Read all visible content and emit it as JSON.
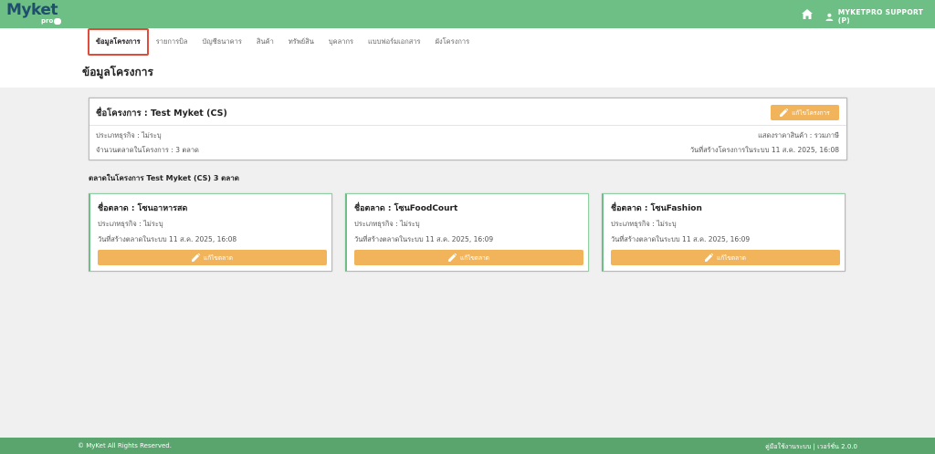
{
  "header": {
    "logo_text": "Myket",
    "logo_sub": "pro",
    "user_name": "MYKETPRO SUPPORT (P)"
  },
  "nav": {
    "tabs": [
      {
        "label": "ข้อมูลโครงการ",
        "active": true
      },
      {
        "label": "รายการบิล"
      },
      {
        "label": "บัญชีธนาคาร"
      },
      {
        "label": "สินค้า"
      },
      {
        "label": "ทรัพย์สิน"
      },
      {
        "label": "บุคลากร"
      },
      {
        "label": "แบบฟอร์มเอกสาร"
      },
      {
        "label": "ผังโครงการ"
      }
    ],
    "page_title": "ข้อมูลโครงการ"
  },
  "project": {
    "title": "ชื่อโครงการ : Test Myket (CS)",
    "edit_label": "แก้ไขโครงการ",
    "business_type": "ประเภทธุรกิจ : ไม่ระบุ",
    "market_count": "จำนวนตลาดในโครงการ : 3 ตลาด",
    "price_display": "แสดงราคาสินค้า : รวมภาษี",
    "created": "วันที่สร้างโครงการในระบบ 11 ส.ค. 2025, 16:08"
  },
  "markets_section_label": "ตลาดในโครงการ Test Myket (CS) 3 ตลาด",
  "markets": [
    {
      "title": "ชื่อตลาด : โซนอาหารสด",
      "business_type": "ประเภทธุรกิจ : ไม่ระบุ",
      "created": "วันที่สร้างตลาดในระบบ 11 ส.ค. 2025, 16:08",
      "edit_label": "แก้ไขตลาด"
    },
    {
      "title": "ชื่อตลาด : โซนFoodCourt",
      "business_type": "ประเภทธุรกิจ : ไม่ระบุ",
      "created": "วันที่สร้างตลาดในระบบ 11 ส.ค. 2025, 16:09",
      "edit_label": "แก้ไขตลาด"
    },
    {
      "title": "ชื่อตลาด : โซนFashion",
      "business_type": "ประเภทธุรกิจ : ไม่ระบุ",
      "created": "วันที่สร้างตลาดในระบบ 11 ส.ค. 2025, 16:09",
      "edit_label": "แก้ไขตลาด"
    }
  ],
  "footer": {
    "copyright": "© MyKet All Rights Reserved.",
    "version": "คู่มือใช้งานระบบ | เวอร์ชั่น 2.0.0"
  },
  "colors": {
    "header_green": "#6dbf85",
    "footer_green": "#5aa46e",
    "button_orange": "#f2b45a",
    "active_tab_border": "#e04b3b"
  }
}
